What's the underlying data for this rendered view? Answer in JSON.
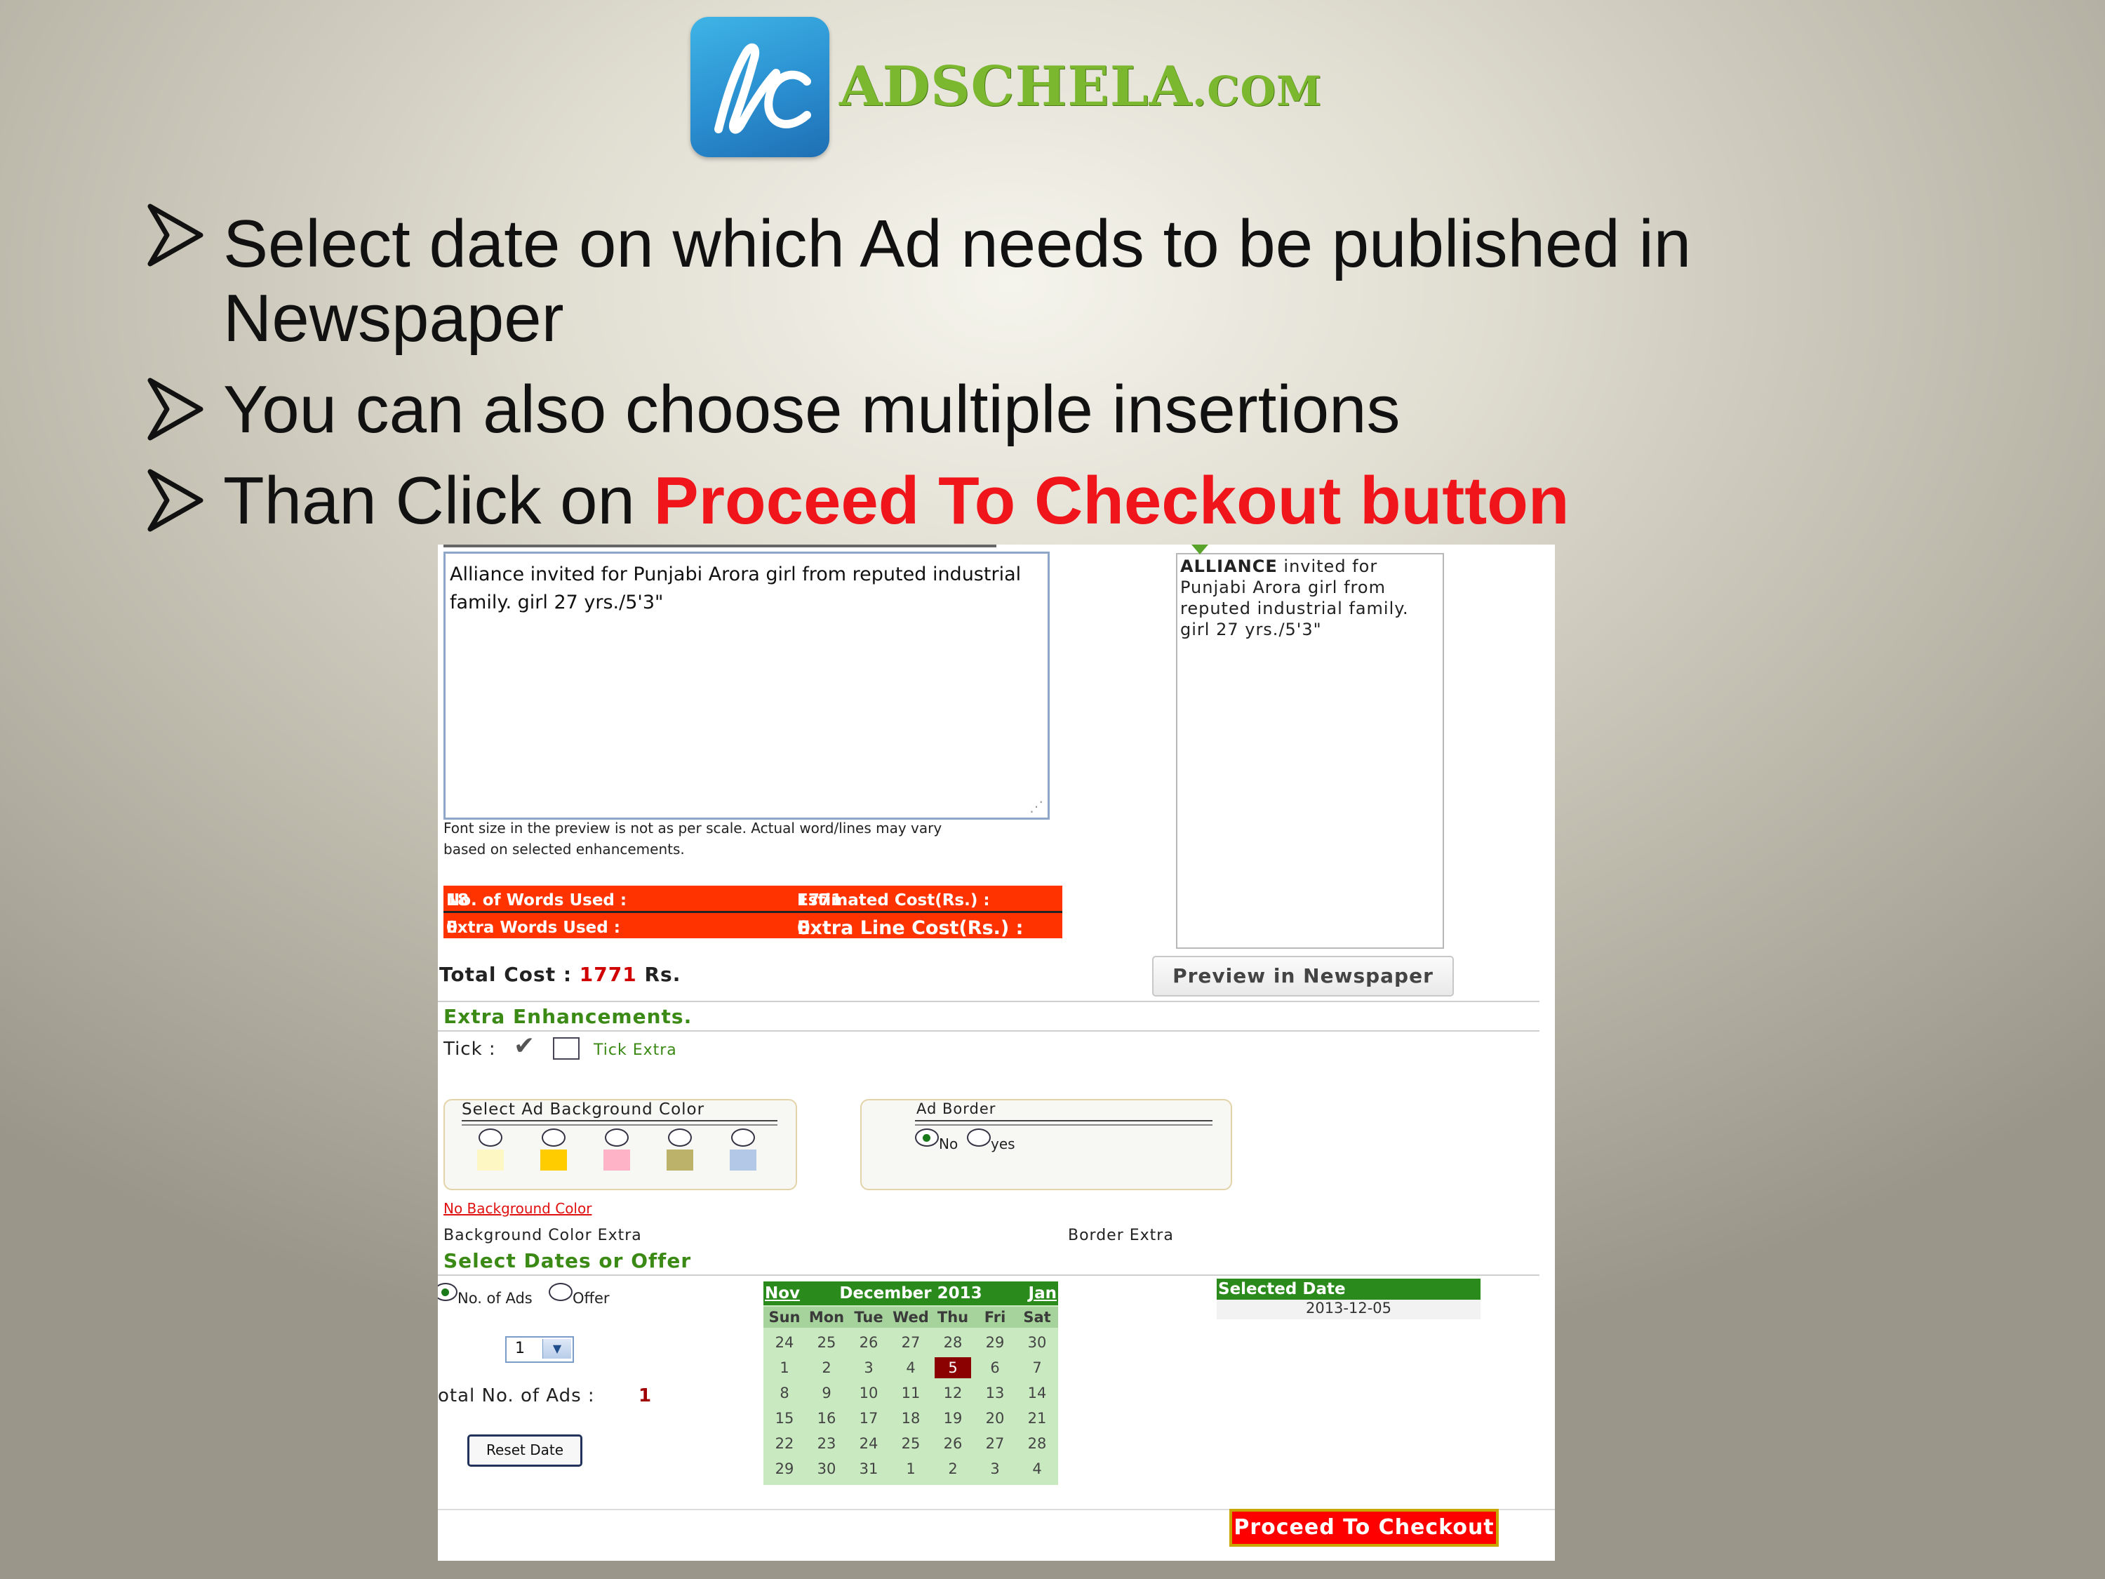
{
  "brand": {
    "logo_text": "ADSCHELA",
    "logo_suffix": ".COM"
  },
  "bullets": [
    {
      "text_line1": " Select date on which Ad needs to be published in",
      "text_line2": "Newspaper"
    },
    {
      "text": "You can also choose multiple insertions"
    },
    {
      "text_prefix": "Than Click on ",
      "text_accent": "Proceed To Checkout button"
    }
  ],
  "form": {
    "ad_text": "Alliance invited for Punjabi Arora girl from reputed industrial family. girl 27 yrs./5'3\"",
    "preview_bold": "ALLIANCE",
    "preview_rest": " invited for Punjabi Arora girl from reputed industrial family. girl 27 yrs./5'3\"",
    "font_note_line1": "Font size in the preview is not as per scale. Actual word/lines may vary",
    "font_note_line2": "based on selected enhancements.",
    "words_used_label": "No. of Words Used :",
    "words_used": "18",
    "estimated_cost_label": "Estimated Cost(Rs.) :",
    "estimated_cost": "1771",
    "extra_words_label": "Extra Words Used :",
    "extra_words": "0",
    "extra_line_cost_label": "Extra Line Cost(Rs.) :",
    "extra_line_cost": "0",
    "total_cost_label": "Total Cost :",
    "total_cost": "1771",
    "total_cost_unit": "Rs.",
    "preview_button": "Preview in Newspaper",
    "extra_enhancements_title": "Extra Enhancements.",
    "tick_label": "Tick :",
    "tick_extra_label": "Tick Extra",
    "bg_color_legend": "Select Ad Background Color",
    "bg_swatches": [
      "#fdf7c3",
      "#ffcc00",
      "#ffb3c6",
      "#bdb26a",
      "#b3c8e6"
    ],
    "border_legend": "Ad Border",
    "border_no": "No",
    "border_yes": "yes",
    "no_bg_color_link": "No Background Color",
    "bg_color_extra": "Background Color Extra",
    "border_extra": "Border Extra",
    "dates_title": "Select Dates or Offer",
    "opt_no_of_ads": "No. of Ads",
    "opt_offer": "Offer",
    "ads_count_select": "1",
    "total_ads_label": "otal No. of Ads :",
    "total_ads": "1",
    "reset_button": "Reset Date",
    "selected_date_title": "Selected Date",
    "selected_date": "2013-12-05",
    "checkout_button": "Proceed To Checkout"
  },
  "calendar": {
    "prev": "Nov",
    "title": "December 2013",
    "next": "Jan",
    "weekdays": [
      "Sun",
      "Mon",
      "Tue",
      "Wed",
      "Thu",
      "Fri",
      "Sat"
    ],
    "weeks": [
      [
        "24",
        "25",
        "26",
        "27",
        "28",
        "29",
        "30"
      ],
      [
        "1",
        "2",
        "3",
        "4",
        "5",
        "6",
        "7"
      ],
      [
        "8",
        "9",
        "10",
        "11",
        "12",
        "13",
        "14"
      ],
      [
        "15",
        "16",
        "17",
        "18",
        "19",
        "20",
        "21"
      ],
      [
        "22",
        "23",
        "24",
        "25",
        "26",
        "27",
        "28"
      ],
      [
        "29",
        "30",
        "31",
        "1",
        "2",
        "3",
        "4"
      ]
    ],
    "selected": "5"
  },
  "colors": {
    "accent_red": "#f0151b",
    "stats_bar": "#ff3300",
    "section_green": "#3b8a16",
    "calendar_green": "#2a8a1c"
  }
}
